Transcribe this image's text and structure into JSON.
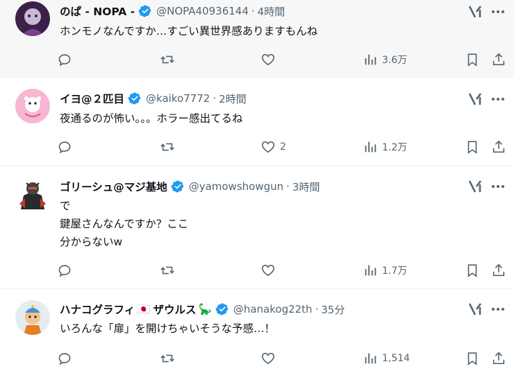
{
  "tweets": [
    {
      "display_name": "のぱ - NOPA -",
      "emoji": "",
      "handle": "@NOPA40936144",
      "dot": "·",
      "time": "4時間",
      "lines": [
        "ホンモノなんですか…すごい異世界感ありますもんね"
      ],
      "reply_count": "",
      "retweet_count": "",
      "like_count": "",
      "views": "3.6万",
      "avatar_color": "#4a2c5a"
    },
    {
      "display_name": "イヨ@２匹目",
      "emoji": "",
      "handle": "@kaiko7772",
      "dot": "·",
      "time": "2時間",
      "lines": [
        "夜通るのが怖い。。。ホラー感出てるね"
      ],
      "reply_count": "",
      "retweet_count": "",
      "like_count": "2",
      "views": "1.2万",
      "avatar_color": "#f5a6c8"
    },
    {
      "display_name": "ゴリーシュ@マジ基地",
      "emoji": "",
      "handle": "@yamowshowgun",
      "dot": "·",
      "time": "3時間",
      "lines": [
        "で",
        "鍵屋さんなんですか？ここ",
        "分からないw"
      ],
      "reply_count": "",
      "retweet_count": "",
      "like_count": "",
      "views": "1.7万",
      "avatar_color": "#ffffff"
    },
    {
      "display_name": "ハナコグラフィ",
      "name_suffix": "ザウルス",
      "flag_emoji": "🇯🇵",
      "emoji": "🦕",
      "handle": "@hanakog22th",
      "dot": "·",
      "time": "35分",
      "lines": [
        "いろんな「扉」を開けちゃいそうな予感…！"
      ],
      "reply_count": "",
      "retweet_count": "",
      "like_count": "",
      "views": "1,514",
      "avatar_color": "#dfe8f0"
    }
  ],
  "colors": {
    "verified": "#1d9bf0",
    "icon": "#536471",
    "text": "#0f1419",
    "hover_bg": "#f7f7f7"
  },
  "icons": [
    "verified-badge-icon",
    "grok-icon",
    "more-icon",
    "reply-icon",
    "retweet-icon",
    "like-icon",
    "views-icon",
    "bookmark-icon",
    "share-icon"
  ]
}
